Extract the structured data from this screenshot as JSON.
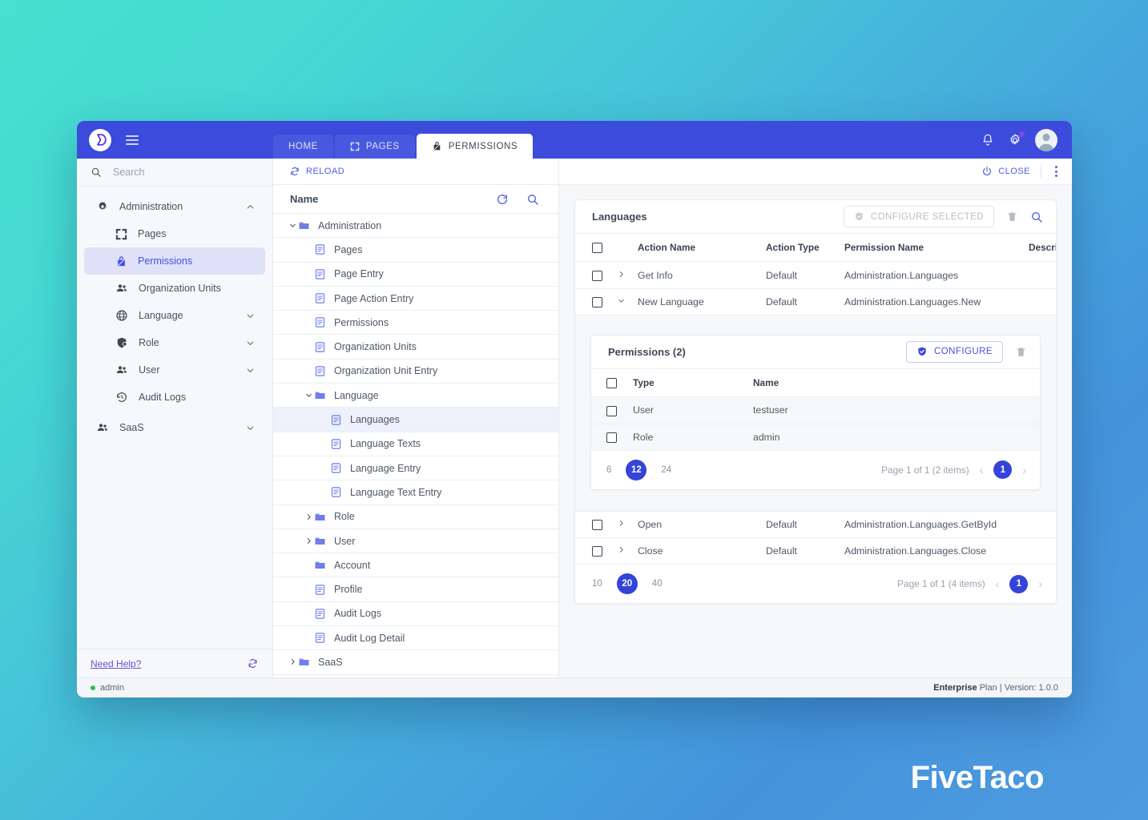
{
  "brand": {
    "logo_glyph": "logo-icon",
    "watermark": "FiveTaco",
    "accent": "#3c4bdb",
    "accent_dark": "#3443d8",
    "bg_from": "#45e0cf",
    "bg_to": "#4e9ade"
  },
  "topbar": {
    "tabs": [
      {
        "label": "HOME",
        "icon": "",
        "active": false
      },
      {
        "label": "PAGES",
        "icon": "expand-icon",
        "active": false
      },
      {
        "label": "PERMISSIONS",
        "icon": "permissions-icon",
        "active": true
      }
    ],
    "icons": [
      "bell-icon",
      "gear-icon",
      "avatar-icon"
    ],
    "notification_dot": true
  },
  "sidebar": {
    "search": {
      "placeholder": "Search",
      "value": ""
    },
    "groups": [
      {
        "label": "Administration",
        "icon": "gear-icon",
        "expanded": true,
        "chevron": "chevron-up-icon",
        "items": [
          {
            "label": "Pages",
            "icon": "pages-icon",
            "chevron": "",
            "active": false
          },
          {
            "label": "Permissions",
            "icon": "permissions-icon",
            "chevron": "",
            "active": true
          },
          {
            "label": "Organization Units",
            "icon": "people-icon",
            "chevron": "",
            "active": false
          },
          {
            "label": "Language",
            "icon": "globe-icon",
            "chevron": "chevron-down-icon",
            "active": false
          },
          {
            "label": "Role",
            "icon": "role-icon",
            "chevron": "chevron-down-icon",
            "active": false
          },
          {
            "label": "User",
            "icon": "people-icon",
            "chevron": "chevron-down-icon",
            "active": false
          },
          {
            "label": "Audit Logs",
            "icon": "history-icon",
            "chevron": "",
            "active": false
          }
        ]
      },
      {
        "label": "SaaS",
        "icon": "people-icon",
        "expanded": false,
        "chevron": "chevron-down-icon",
        "items": []
      }
    ],
    "footer": {
      "help_label": "Need Help?",
      "refresh_icon": "refresh-icon"
    }
  },
  "toolbar": {
    "reload_label": "RELOAD",
    "reload_icon": "reload-icon",
    "close_label": "CLOSE",
    "close_icon": "power-icon",
    "kebab_icon": "more-vertical-icon"
  },
  "tree": {
    "header": {
      "title": "Name",
      "refresh_icon": "refresh-icon",
      "search_icon": "search-icon"
    },
    "rows": [
      {
        "label": "Administration",
        "depth": 0,
        "caret": "chevron-down-icon",
        "icon": "folder-icon",
        "selected": false
      },
      {
        "label": "Pages",
        "depth": 1,
        "caret": "",
        "icon": "file-icon",
        "selected": false
      },
      {
        "label": "Page Entry",
        "depth": 1,
        "caret": "",
        "icon": "file-icon",
        "selected": false
      },
      {
        "label": "Page Action Entry",
        "depth": 1,
        "caret": "",
        "icon": "file-icon",
        "selected": false
      },
      {
        "label": "Permissions",
        "depth": 1,
        "caret": "",
        "icon": "file-icon",
        "selected": false
      },
      {
        "label": "Organization Units",
        "depth": 1,
        "caret": "",
        "icon": "file-icon",
        "selected": false
      },
      {
        "label": "Organization Unit Entry",
        "depth": 1,
        "caret": "",
        "icon": "file-icon",
        "selected": false
      },
      {
        "label": "Language",
        "depth": 1,
        "caret": "chevron-down-icon",
        "icon": "folder-icon",
        "selected": false
      },
      {
        "label": "Languages",
        "depth": 2,
        "caret": "",
        "icon": "file-icon",
        "selected": true
      },
      {
        "label": "Language Texts",
        "depth": 2,
        "caret": "",
        "icon": "file-icon",
        "selected": false
      },
      {
        "label": "Language Entry",
        "depth": 2,
        "caret": "",
        "icon": "file-icon",
        "selected": false
      },
      {
        "label": "Language Text Entry",
        "depth": 2,
        "caret": "",
        "icon": "file-icon",
        "selected": false
      },
      {
        "label": "Role",
        "depth": 1,
        "caret": "chevron-right-icon",
        "icon": "folder-icon",
        "selected": false
      },
      {
        "label": "User",
        "depth": 1,
        "caret": "chevron-right-icon",
        "icon": "folder-icon",
        "selected": false
      },
      {
        "label": "Account",
        "depth": 1,
        "caret": "",
        "icon": "folder-icon",
        "selected": false
      },
      {
        "label": "Profile",
        "depth": 1,
        "caret": "",
        "icon": "file-icon",
        "selected": false
      },
      {
        "label": "Audit Logs",
        "depth": 1,
        "caret": "",
        "icon": "file-icon",
        "selected": false
      },
      {
        "label": "Audit Log Detail",
        "depth": 1,
        "caret": "",
        "icon": "file-icon",
        "selected": false
      },
      {
        "label": "SaaS",
        "depth": 0,
        "caret": "chevron-right-icon",
        "icon": "folder-icon",
        "selected": false
      }
    ]
  },
  "main": {
    "card_title": "Languages",
    "configure_selected_label": "CONFIGURE SELECTED",
    "configure_selected_enabled": false,
    "delete_icon": "trash-icon",
    "search_icon": "search-icon",
    "columns": [
      "Action Name",
      "Action Type",
      "Permission Name",
      "Description"
    ],
    "rows": [
      {
        "caret": "chevron-right-icon",
        "action_name": "Get Info",
        "action_type": "Default",
        "permission_name": "Administration.Languages",
        "description": "",
        "expanded": false
      },
      {
        "caret": "chevron-down-icon",
        "action_name": "New Language",
        "action_type": "Default",
        "permission_name": "Administration.Languages.New",
        "description": "",
        "expanded": true
      },
      {
        "caret": "chevron-right-icon",
        "action_name": "Open",
        "action_type": "Default",
        "permission_name": "Administration.Languages.GetById",
        "description": "",
        "expanded": false
      },
      {
        "caret": "chevron-right-icon",
        "action_name": "Close",
        "action_type": "Default",
        "permission_name": "Administration.Languages.Close",
        "description": "",
        "expanded": false
      }
    ],
    "pager": {
      "sizes": [
        "10",
        "20",
        "40"
      ],
      "active_size": "20",
      "info": "Page 1 of 1 (4 items)",
      "prev_icon": "chevron-left-icon",
      "next_icon": "chevron-right-icon",
      "current_page": "1"
    },
    "nested": {
      "title": "Permissions (2)",
      "configure_label": "CONFIGURE",
      "configure_icon": "shield-check-icon",
      "delete_icon": "trash-icon",
      "columns": [
        "Type",
        "Name"
      ],
      "rows": [
        {
          "type": "User",
          "name": "testuser"
        },
        {
          "type": "Role",
          "name": "admin"
        }
      ],
      "pager": {
        "sizes": [
          "6",
          "12",
          "24"
        ],
        "active_size": "12",
        "info": "Page 1 of 1 (2 items)",
        "prev_icon": "chevron-left-icon",
        "next_icon": "chevron-right-icon",
        "current_page": "1"
      }
    }
  },
  "statusbar": {
    "user": "admin",
    "online": true,
    "plan_name": "Enterprise",
    "plan_suffix": " Plan",
    "separator": " | ",
    "version": "Version: 1.0.0"
  }
}
